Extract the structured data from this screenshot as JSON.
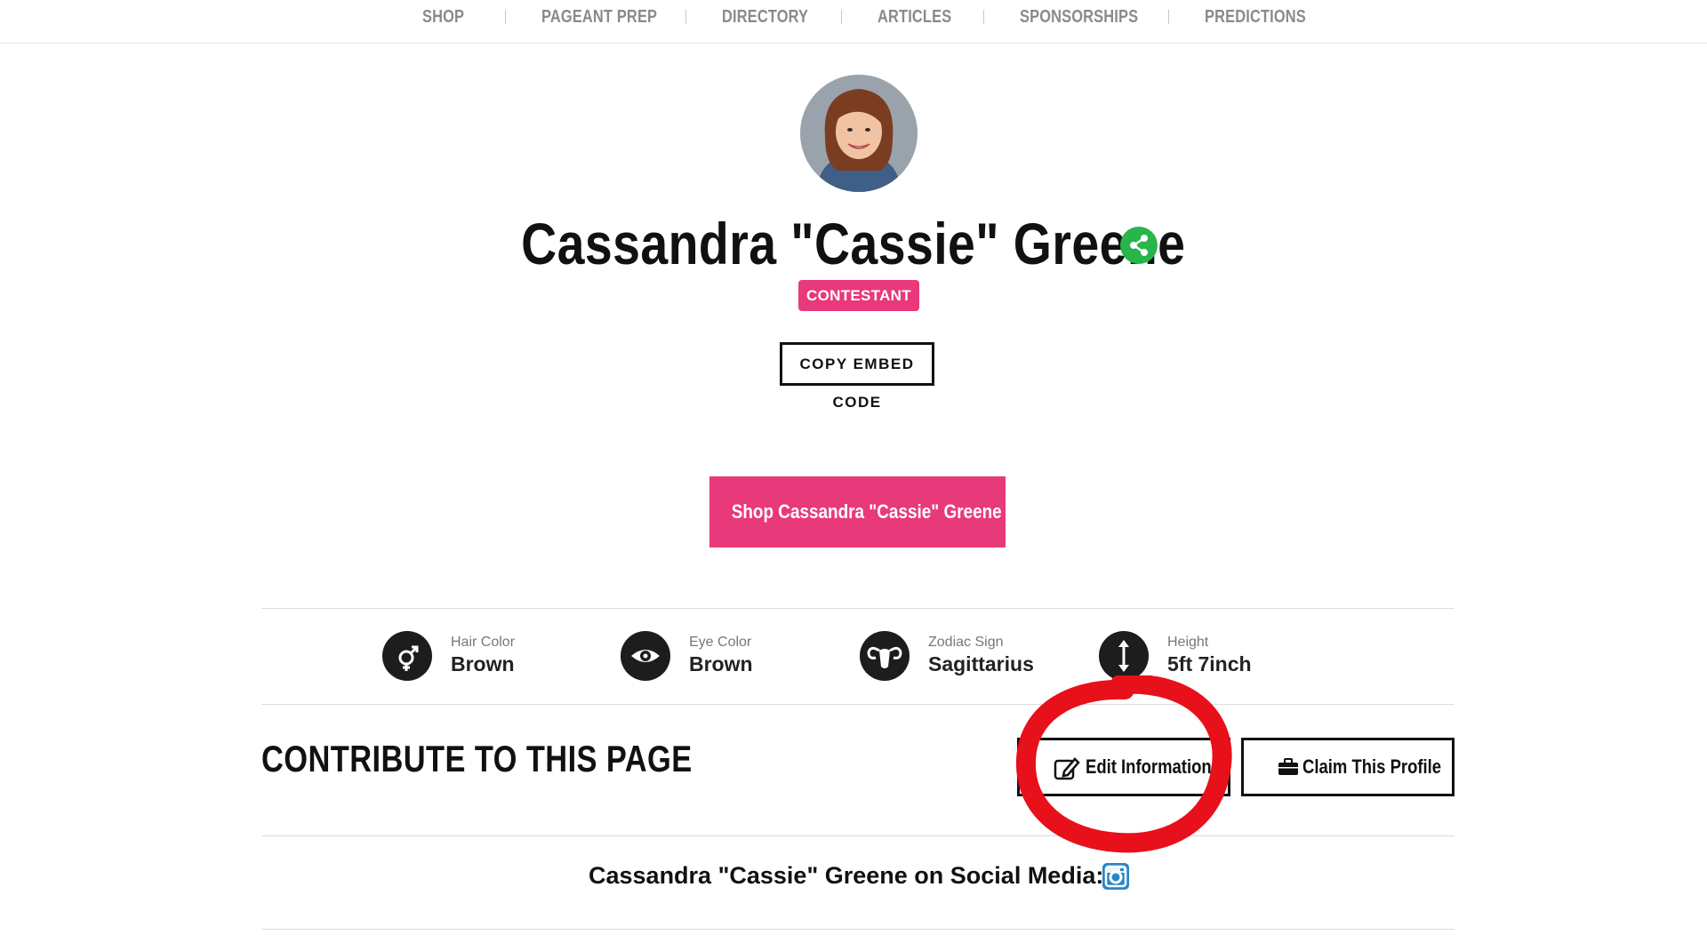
{
  "nav": {
    "items": [
      "SHOP",
      "PAGEANT PREP",
      "DIRECTORY",
      "ARTICLES",
      "SPONSORSHIPS",
      "PREDICTIONS"
    ]
  },
  "profile": {
    "name": "Cassandra \"Cassie\" Greene",
    "role_badge": "CONTESTANT",
    "embed_button": "COPY EMBED CODE",
    "shop_button": "Shop Cassandra \"Cassie\" Greene"
  },
  "attributes": [
    {
      "label": "Hair Color",
      "value": "Brown",
      "icon": "gender-icon"
    },
    {
      "label": "Eye Color",
      "value": "Brown",
      "icon": "eye-icon"
    },
    {
      "label": "Zodiac Sign",
      "value": "Sagittarius",
      "icon": "ram-icon"
    },
    {
      "label": "Height",
      "value": "5ft 7inch",
      "icon": "height-arrows-icon"
    }
  ],
  "contribute": {
    "heading": "CONTRIBUTE TO THIS PAGE",
    "edit_button": "Edit Information",
    "claim_button": "Claim This Profile"
  },
  "social": {
    "text": "Cassandra \"Cassie\" Greene on Social Media:"
  },
  "colors": {
    "accent_pink": "#e8397a",
    "share_green": "#28b54a",
    "instagram_blue": "#2a86c4",
    "annotation_red": "#e8101a"
  }
}
